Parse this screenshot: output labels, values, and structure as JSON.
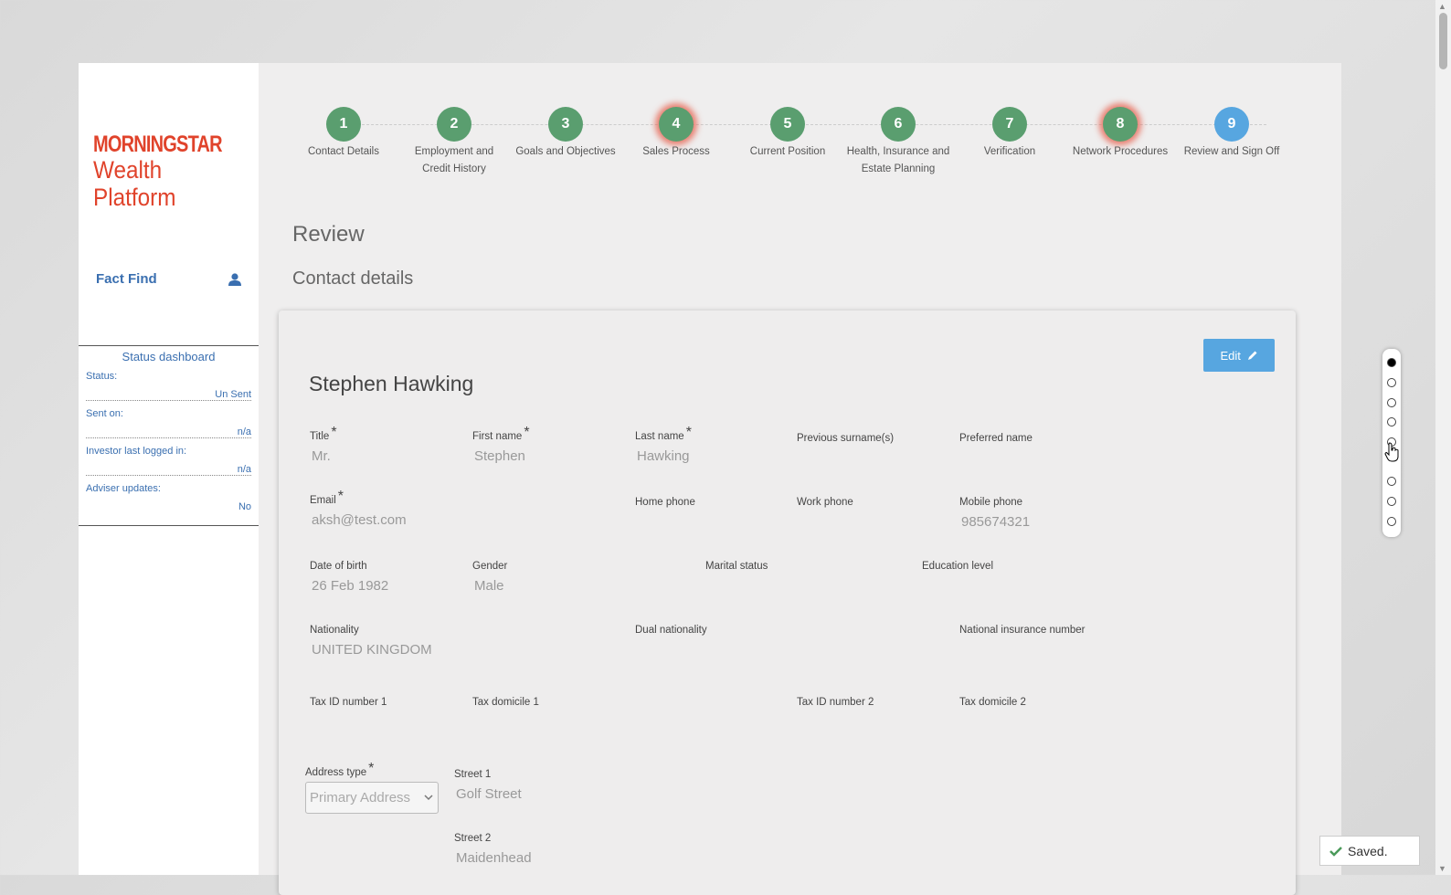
{
  "logo": {
    "line1": "MORNINGSTAR",
    "line2": "Wealth Platform",
    "color": "#e0432b"
  },
  "sidebar": {
    "fact_find": "Fact Find"
  },
  "status_dashboard": {
    "title": "Status dashboard",
    "rows": [
      {
        "label": "Status:",
        "value": "Un Sent"
      },
      {
        "label": "Sent on:",
        "value": "n/a"
      },
      {
        "label": "Investor last logged in:",
        "value": "n/a"
      },
      {
        "label": "Adviser updates:",
        "value": "No"
      }
    ]
  },
  "steps": [
    {
      "num": "1",
      "label": "Contact Details",
      "state": "done"
    },
    {
      "num": "2",
      "label": "Employment and Credit History",
      "state": "done"
    },
    {
      "num": "3",
      "label": "Goals and Objectives",
      "state": "done"
    },
    {
      "num": "4",
      "label": "Sales Process",
      "state": "warning"
    },
    {
      "num": "5",
      "label": "Current Position",
      "state": "done"
    },
    {
      "num": "6",
      "label": "Health, Insurance and Estate Planning",
      "state": "done"
    },
    {
      "num": "7",
      "label": "Verification",
      "state": "done"
    },
    {
      "num": "8",
      "label": "Network Procedures",
      "state": "warning"
    },
    {
      "num": "9",
      "label": "Review and Sign Off",
      "state": "current"
    }
  ],
  "page": {
    "heading": "Review",
    "subheading": "Contact details"
  },
  "card": {
    "edit_label": "Edit",
    "person_name": "Stephen Hawking",
    "fields": {
      "title": {
        "label": "Title",
        "value": "Mr."
      },
      "first_name": {
        "label": "First name",
        "value": "Stephen"
      },
      "last_name": {
        "label": "Last name",
        "value": "Hawking"
      },
      "previous_surnames": {
        "label": "Previous surname(s)",
        "value": ""
      },
      "preferred_name": {
        "label": "Preferred name",
        "value": ""
      },
      "email": {
        "label": "Email",
        "value": "aksh@test.com"
      },
      "home_phone": {
        "label": "Home phone",
        "value": ""
      },
      "work_phone": {
        "label": "Work phone",
        "value": ""
      },
      "mobile_phone": {
        "label": "Mobile phone",
        "value": "985674321"
      },
      "dob": {
        "label": "Date of birth",
        "value": "26 Feb 1982"
      },
      "gender": {
        "label": "Gender",
        "value": "Male"
      },
      "marital_status": {
        "label": "Marital status",
        "value": ""
      },
      "education_level": {
        "label": "Education level",
        "value": ""
      },
      "nationality": {
        "label": "Nationality",
        "value": "UNITED KINGDOM"
      },
      "dual_nationality": {
        "label": "Dual nationality",
        "value": ""
      },
      "ni_number": {
        "label": "National insurance number",
        "value": ""
      },
      "tax_id_1": {
        "label": "Tax ID number 1",
        "value": ""
      },
      "tax_domicile_1": {
        "label": "Tax domicile 1",
        "value": ""
      },
      "tax_id_2": {
        "label": "Tax ID number 2",
        "value": ""
      },
      "tax_domicile_2": {
        "label": "Tax domicile 2",
        "value": ""
      },
      "address_type": {
        "label": "Address type",
        "value": "Primary Address"
      },
      "street1": {
        "label": "Street 1",
        "value": "Golf Street"
      },
      "street2": {
        "label": "Street 2",
        "value": "Maidenhead"
      }
    }
  },
  "saved_toast": "Saved.",
  "colors": {
    "step_done": "#5a9e6f",
    "step_current": "#57a6e0",
    "accent_blue": "#3a6fb0"
  }
}
